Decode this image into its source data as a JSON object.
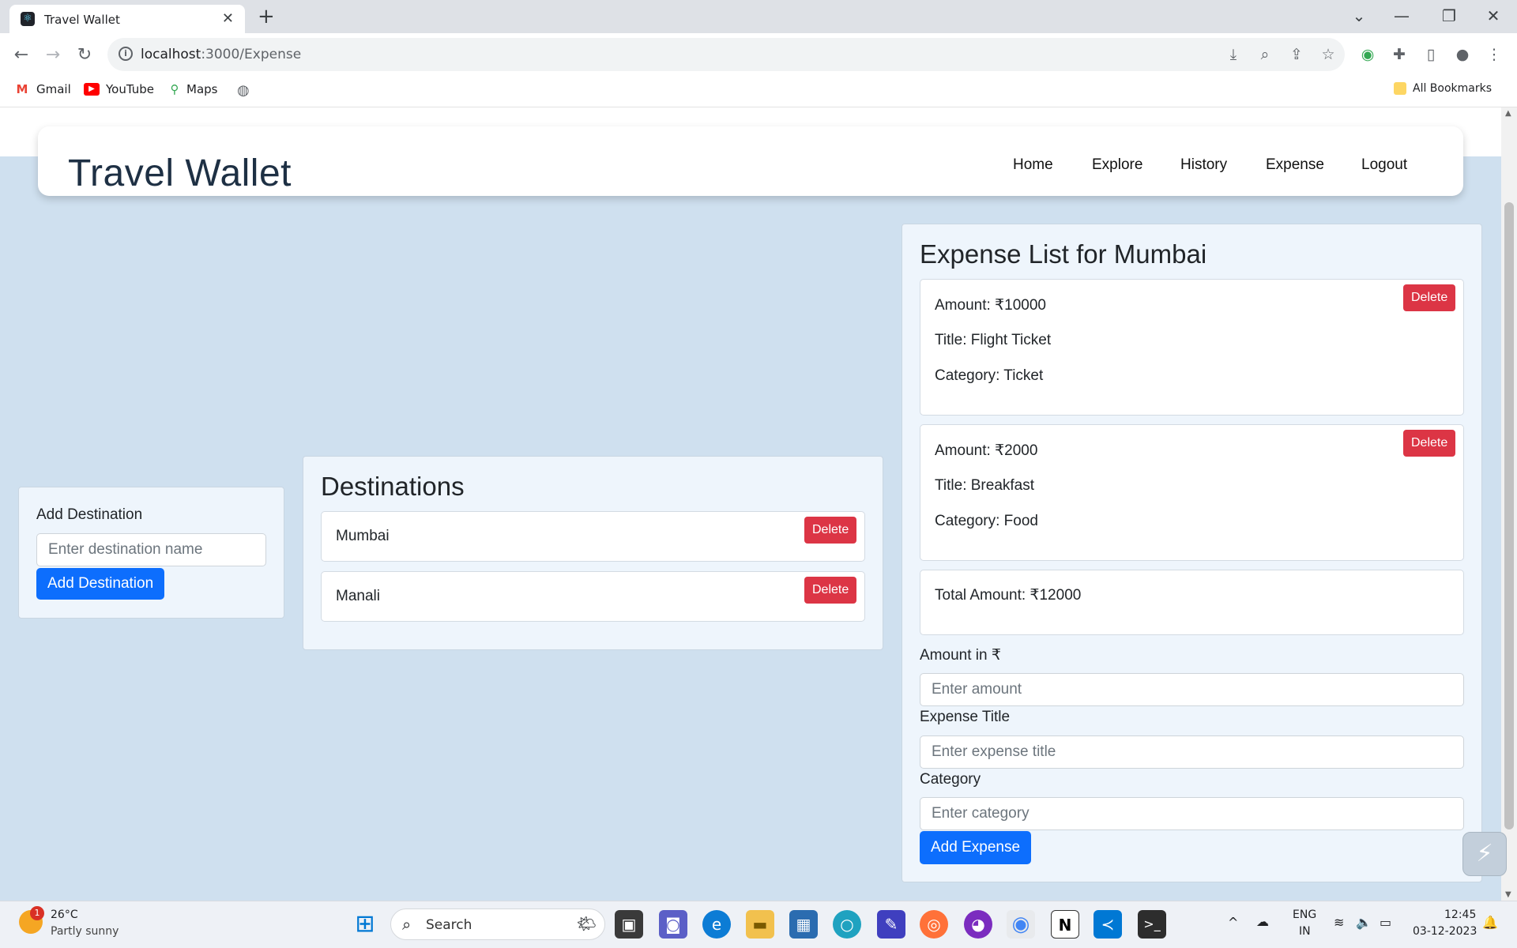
{
  "browser": {
    "tab_title": "Travel Wallet",
    "close_glyph": "✕",
    "newtab_glyph": "+",
    "url_host": "localhost",
    "url_path": ":3000/Expense",
    "bookmarks": [
      {
        "label": "Gmail",
        "icon": "gmail-icon"
      },
      {
        "label": "YouTube",
        "icon": "youtube-icon"
      },
      {
        "label": "Maps",
        "icon": "maps-icon"
      }
    ],
    "all_bookmarks": "All Bookmarks"
  },
  "navbar": {
    "brand": "Travel Wallet",
    "links": [
      "Home",
      "Explore",
      "History",
      "Expense",
      "Logout"
    ]
  },
  "add_destination": {
    "label": "Add Destination",
    "placeholder": "Enter destination name",
    "button": "Add Destination"
  },
  "destinations": {
    "title": "Destinations",
    "items": [
      "Mumbai",
      "Manali"
    ],
    "delete_label": "Delete"
  },
  "expenses": {
    "title": "Expense List for Mumbai",
    "items": [
      {
        "amount": "Amount: ₹10000",
        "title": "Title: Flight Ticket",
        "category": "Category: Ticket"
      },
      {
        "amount": "Amount: ₹2000",
        "title": "Title: Breakfast",
        "category": "Category: Food"
      }
    ],
    "delete_label": "Delete",
    "total": "Total Amount: ₹12000",
    "form": {
      "amount_label": "Amount in ₹",
      "amount_placeholder": "Enter amount",
      "title_label": "Expense Title",
      "title_placeholder": "Enter expense title",
      "category_label": "Category",
      "category_placeholder": "Enter category",
      "button": "Add Expense"
    }
  },
  "taskbar": {
    "weather_temp": "26°C",
    "weather_desc": "Partly sunny",
    "weather_badge": "1",
    "search_label": "Search",
    "lang1": "ENG",
    "lang2": "IN",
    "time": "12:45",
    "date": "03-12-2023"
  },
  "colors": {
    "page_bg": "#cfe0ef",
    "delete": "#dc3545",
    "primary": "#0d6efd"
  }
}
